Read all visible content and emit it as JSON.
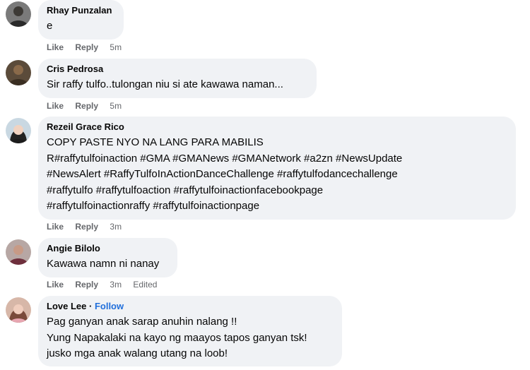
{
  "comments": [
    {
      "author": "Rhay Punzalan",
      "lines": [
        "e"
      ],
      "like": "Like",
      "reply": "Reply",
      "time": "5m"
    },
    {
      "author": "Cris Pedrosa",
      "lines": [
        "Sir raffy tulfo..tulongan niu si ate kawawa naman..."
      ],
      "like": "Like",
      "reply": "Reply",
      "time": "5m"
    },
    {
      "author": "Rezeil Grace Rico",
      "lines": [
        "COPY PASTE NYO NA LANG PARA MABILIS",
        "R#raffytulfoinaction #GMA #GMANews #GMANetwork #a2zn #NewsUpdate",
        "#NewsAlert #RaffyTulfoInActionDanceChallenge #raffytulfodancechallenge",
        "#raffytulfo #raffytulfoaction #raffytulfoinactionfacebookpage",
        "#raffytulfoinactionraffy #raffytulfoinactionpage"
      ],
      "like": "Like",
      "reply": "Reply",
      "time": "3m"
    },
    {
      "author": "Angie Bilolo",
      "lines": [
        "Kawawa namn ni nanay"
      ],
      "like": "Like",
      "reply": "Reply",
      "time": "3m",
      "edited": "Edited"
    },
    {
      "author": "Love Lee",
      "separator": "·",
      "follow": "Follow",
      "lines": [
        "Pag ganyan anak sarap anuhin nalang !!",
        "Yung Napakalaki na kayo ng maayos tapos ganyan tsk!",
        "jusko mga anak walang utang na loob!"
      ]
    }
  ]
}
